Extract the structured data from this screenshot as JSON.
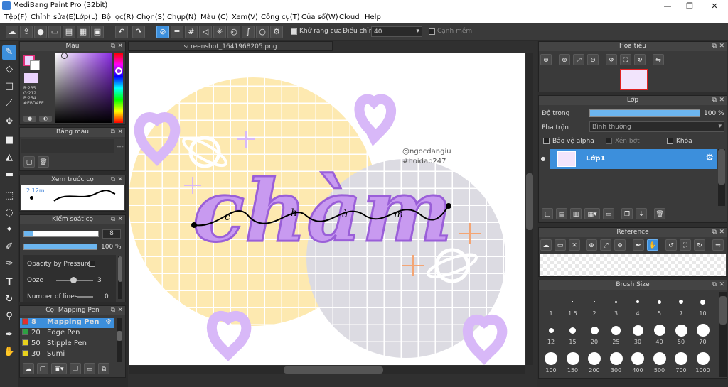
{
  "window": {
    "title": "MediBang Paint Pro (32bit)",
    "minimize": "—",
    "restore": "❐",
    "close": "✕"
  },
  "menu": [
    "Tệp(F)",
    "Chỉnh sửa(E)",
    "Lớp(L)",
    "Bộ lọc(R)",
    "Chọn(S)",
    "Chụp(N)",
    "Màu (C)",
    "Xem(V)",
    "Công cụ(T)",
    "Cửa sổ(W)",
    "Cloud",
    "Help"
  ],
  "toolbar": {
    "antialias_label": "Khử răng cưa",
    "adjust_label": "Điều chỉnh",
    "adjust_value": "40",
    "soft_edge_label": "Cạnh mềm"
  },
  "color_panel": {
    "title": "Màu",
    "r": "R:235",
    "g": "G:212",
    "b": "B:254",
    "hex": "#EBD4FE",
    "primary": "#EBD4FE"
  },
  "palette_panel": {
    "title": "Bảng màu"
  },
  "brush_preview": {
    "title": "Xem trước cọ",
    "size": "2.12m"
  },
  "brush_control": {
    "title": "Kiểm soát cọ",
    "size_value": "8",
    "opacity_value": "100 %",
    "opacity_pressure": "Opacity by Pressure",
    "ooze_label": "Ooze",
    "ooze_value": "3",
    "lines_label": "Number of lines",
    "lines_value": "0"
  },
  "brush_list": {
    "title": "Cọ: Mapping Pen",
    "items": [
      {
        "size": "8",
        "name": "Mapping Pen",
        "color": "#e03030"
      },
      {
        "size": "20",
        "name": "Edge Pen",
        "color": "#2ea043"
      },
      {
        "size": "50",
        "name": "Stipple Pen",
        "color": "#e8d21d"
      },
      {
        "size": "30",
        "name": "Sumi",
        "color": "#e8d21d"
      }
    ]
  },
  "canvas": {
    "tab_label": "screenshot_1641968205.png",
    "credit_1": "@ngocdangiu",
    "credit_2": "#hoidap247",
    "word": "chàm",
    "script_letters": [
      "c",
      "h",
      "à",
      "m"
    ]
  },
  "navigator": {
    "title": "Hoa tiêu"
  },
  "layer_panel": {
    "title": "Lớp",
    "opacity_label": "Độ trong",
    "opacity_value": "100 %",
    "blend_label": "Pha trộn",
    "blend_value": "Bình thường",
    "protect_alpha": "Bảo vệ alpha",
    "clipping": "Xén bớt",
    "lock": "Khóa",
    "layer_name": "Lớp1"
  },
  "reference_panel": {
    "title": "Reference"
  },
  "brush_size_panel": {
    "title": "Brush Size",
    "sizes": [
      "1",
      "1.5",
      "2",
      "3",
      "4",
      "5",
      "7",
      "10",
      "12",
      "15",
      "20",
      "25",
      "30",
      "40",
      "50",
      "70",
      "100",
      "150",
      "200",
      "300",
      "400",
      "500",
      "700",
      "1000"
    ]
  }
}
